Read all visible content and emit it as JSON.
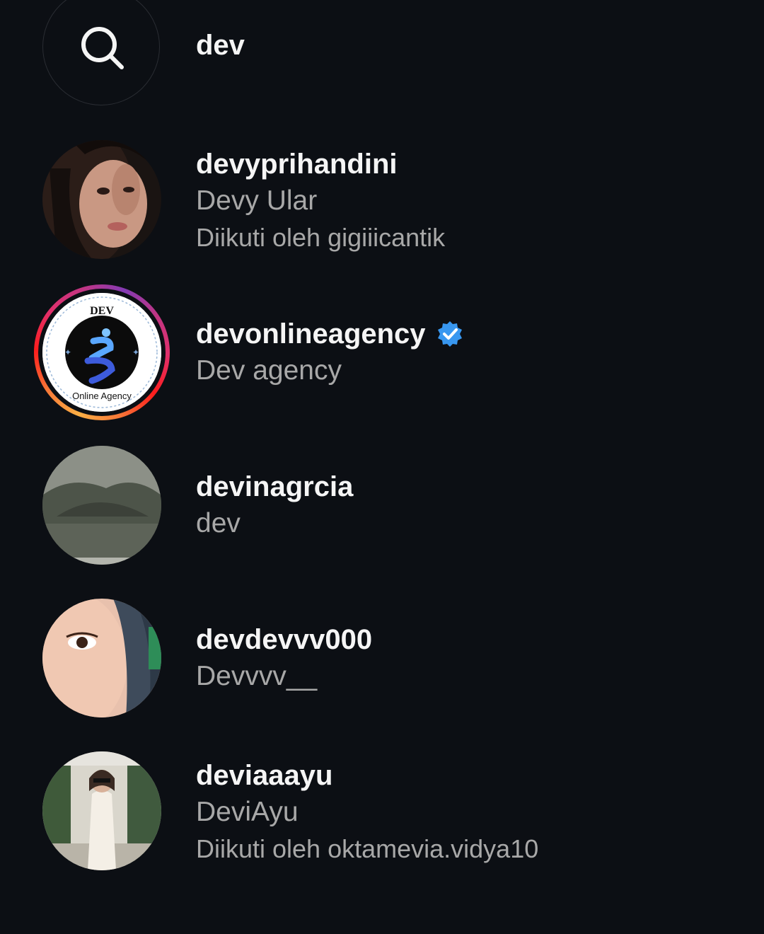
{
  "search": {
    "query": "dev",
    "icon": "search-icon"
  },
  "results": [
    {
      "username": "devyprihandini",
      "full_name": "Devy Ular",
      "followed_by": "Diikuti oleh gigiiicantik",
      "verified": false
    },
    {
      "username": "devonlineagency",
      "full_name": "Dev agency",
      "followed_by": "",
      "verified": true,
      "has_story": true,
      "logo_text_top": "DEV",
      "logo_text_bottom": "Online Agency"
    },
    {
      "username": "devinagrcia",
      "full_name": "dev",
      "followed_by": "",
      "verified": false
    },
    {
      "username": "devdevvv000",
      "full_name": "Devvvv__",
      "followed_by": "",
      "verified": false
    },
    {
      "username": "deviaaayu",
      "full_name": "DeviAyu",
      "followed_by": "Diikuti oleh oktamevia.vidya10",
      "verified": false
    }
  ],
  "colors": {
    "background": "#0c0f14",
    "primary_text": "#f5f5f5",
    "secondary_text": "#a8a8a8",
    "verified_blue": "#3897f0"
  }
}
